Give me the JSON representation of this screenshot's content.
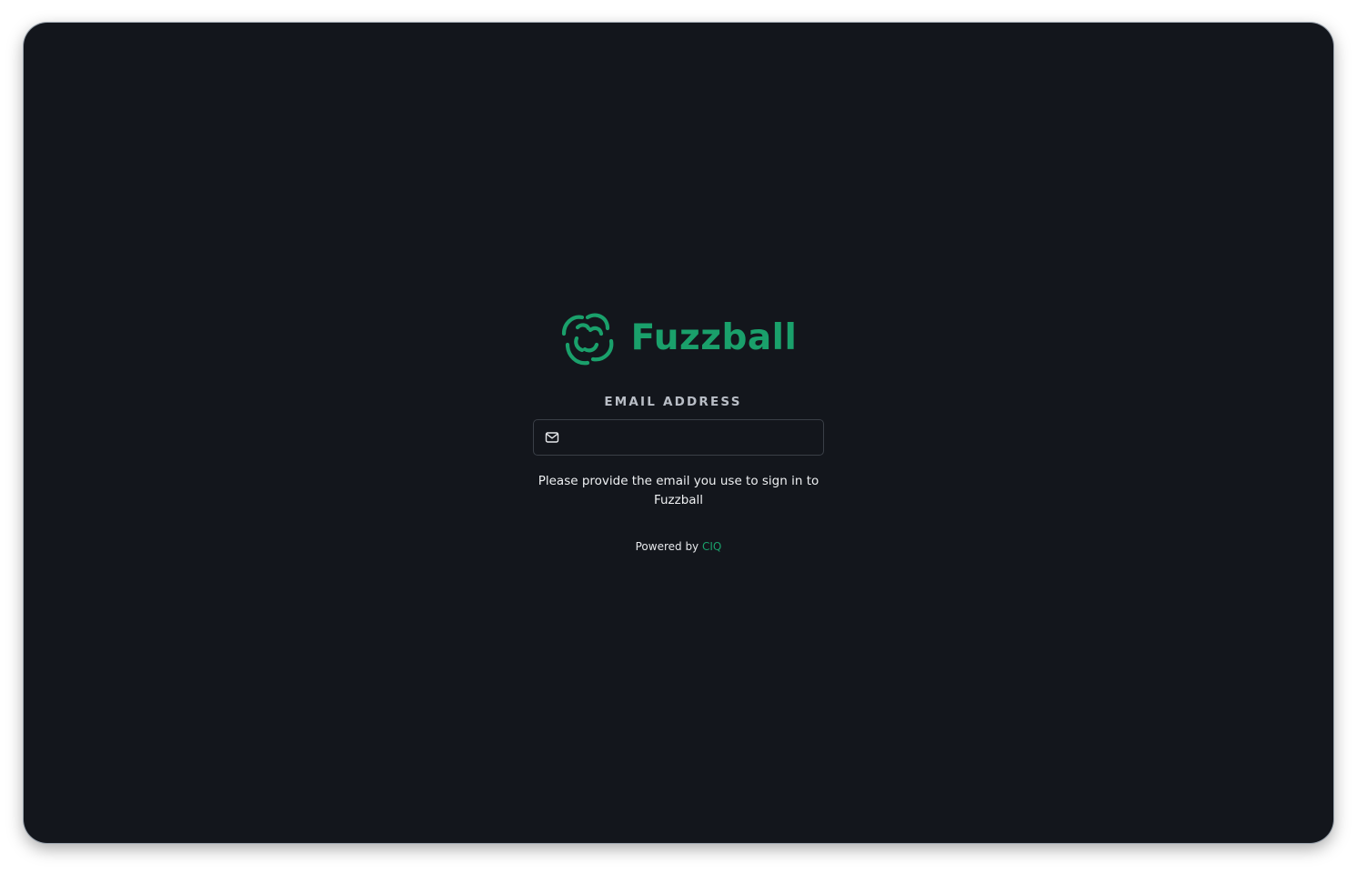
{
  "brand": {
    "name": "Fuzzball",
    "logo_icon": "pinwheel-logo-icon",
    "color": "#1aa06b"
  },
  "form": {
    "email_label": "EMAIL ADDRESS",
    "email_value": "",
    "email_placeholder": "",
    "email_icon": "mail-icon",
    "help_text": "Please provide the email you use to sign in to Fuzzball"
  },
  "footer": {
    "powered_prefix": "Powered by",
    "powered_link": "CIQ"
  },
  "colors": {
    "background": "#13161c",
    "accent": "#1aa06b",
    "input_border": "#3a3f47"
  }
}
